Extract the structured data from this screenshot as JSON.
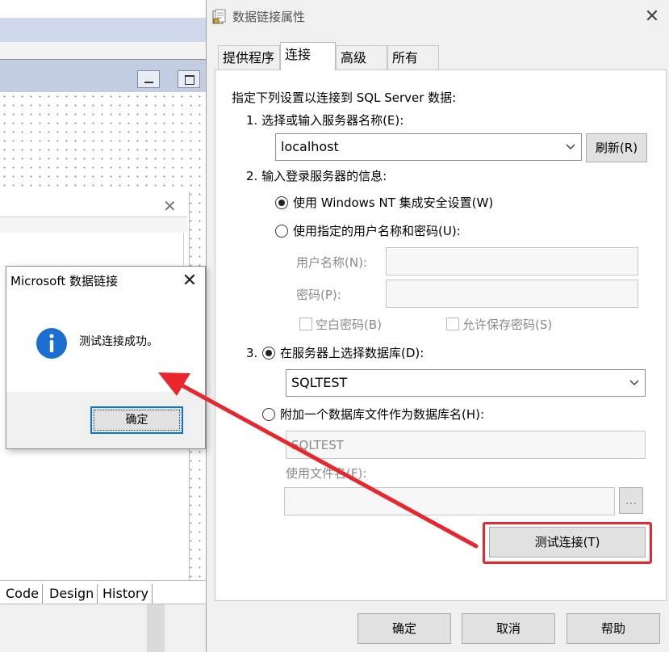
{
  "ide": {
    "tabs": [
      "Code",
      "Design",
      "History"
    ]
  },
  "dialog": {
    "title": "数据链接属性",
    "tabs": [
      "提供程序",
      "连接",
      "高级",
      "所有"
    ],
    "active_tab": "连接",
    "intro": "指定下列设置以连接到 SQL Server 数据:",
    "step1_label": "1. 选择或输入服务器名称(E):",
    "server_name": "localhost",
    "refresh_button": "刷新(R)",
    "step2_label": "2. 输入登录服务器的信息:",
    "radio_windows_nt": "使用 Windows NT 集成安全设置(W)",
    "radio_specific_user": "使用指定的用户名称和密码(U):",
    "username_label": "用户名称(N):",
    "password_label": "密码(P):",
    "blank_password_label": "空白密码(B)",
    "allow_save_password_label": "允许保存密码(S)",
    "step3_number": "3.",
    "radio_select_db": "在服务器上选择数据库(D):",
    "database_name": "SQLTEST",
    "radio_attach_db": "附加一个数据库文件作为数据库名(H):",
    "attach_db_name": "SQLTEST",
    "use_filename_label": "使用文件名(F):",
    "browse_button": "...",
    "test_connection_button": "测试连接(T)",
    "ok_button": "确定",
    "cancel_button": "取消",
    "help_button": "帮助"
  },
  "message_box": {
    "title": "Microsoft 数据链接",
    "message": "测试连接成功。",
    "ok_button": "确定",
    "icon": "info-icon"
  },
  "colors": {
    "annotation_red": "#e8262c",
    "info_blue": "#1a6fd0",
    "focus_blue": "#0078d7"
  }
}
